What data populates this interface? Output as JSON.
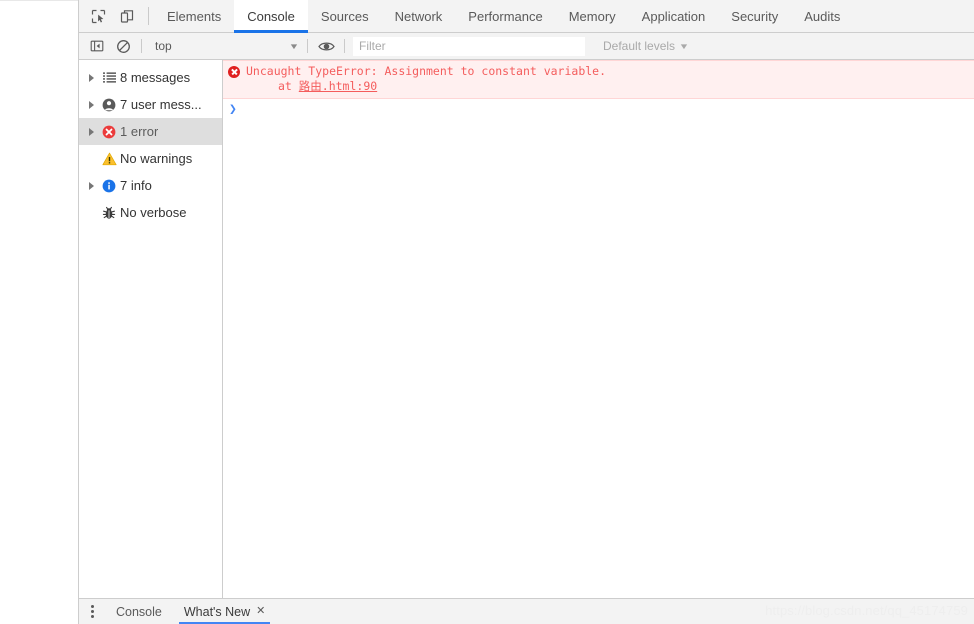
{
  "main_tabs": [
    {
      "label": "Elements",
      "active": false
    },
    {
      "label": "Console",
      "active": true
    },
    {
      "label": "Sources",
      "active": false
    },
    {
      "label": "Network",
      "active": false
    },
    {
      "label": "Performance",
      "active": false
    },
    {
      "label": "Memory",
      "active": false
    },
    {
      "label": "Application",
      "active": false
    },
    {
      "label": "Security",
      "active": false
    },
    {
      "label": "Audits",
      "active": false
    }
  ],
  "toolbar": {
    "inspect_icon": "inspect-element-icon",
    "device_icon": "device-toolbar-icon",
    "sidebar_toggle_icon": "console-sidebar-toggle-icon",
    "clear_icon": "clear-console-icon",
    "eye_icon": "live-expression-eye-icon",
    "context": "top",
    "context_caret": "▼",
    "filter_placeholder": "Filter",
    "filter_value": "",
    "levels_label": "Default levels",
    "levels_caret": "▼"
  },
  "sidebar": {
    "items": [
      {
        "label": "8 messages",
        "icon": "list-icon",
        "arrow": true,
        "selected": false
      },
      {
        "label": "7 user mess...",
        "icon": "person-icon",
        "arrow": true,
        "selected": false
      },
      {
        "label": "1 error",
        "icon": "error-icon",
        "arrow": true,
        "selected": true
      },
      {
        "label": "No warnings",
        "icon": "warning-icon",
        "arrow": false,
        "selected": false
      },
      {
        "label": "7 info",
        "icon": "info-icon",
        "arrow": true,
        "selected": false
      },
      {
        "label": "No verbose",
        "icon": "bug-icon",
        "arrow": false,
        "selected": false
      }
    ]
  },
  "console": {
    "error": {
      "text": "Uncaught TypeError: Assignment to constant variable.",
      "stack_prefix": "at ",
      "stack_link": "路由.html:90",
      "badge_icon": "error-circle-icon",
      "text_color": "#f45d5d",
      "background": "#fff0f0"
    },
    "prompt_caret": "❯"
  },
  "drawer": {
    "menu_icon": "kebab-menu-icon",
    "tabs": [
      {
        "label": "Console",
        "active": false,
        "closable": false
      },
      {
        "label": "What's New",
        "active": true,
        "closable": true,
        "close_icon": "✕"
      }
    ]
  },
  "watermark": "https://blog.csdn.net/qq_45174759"
}
